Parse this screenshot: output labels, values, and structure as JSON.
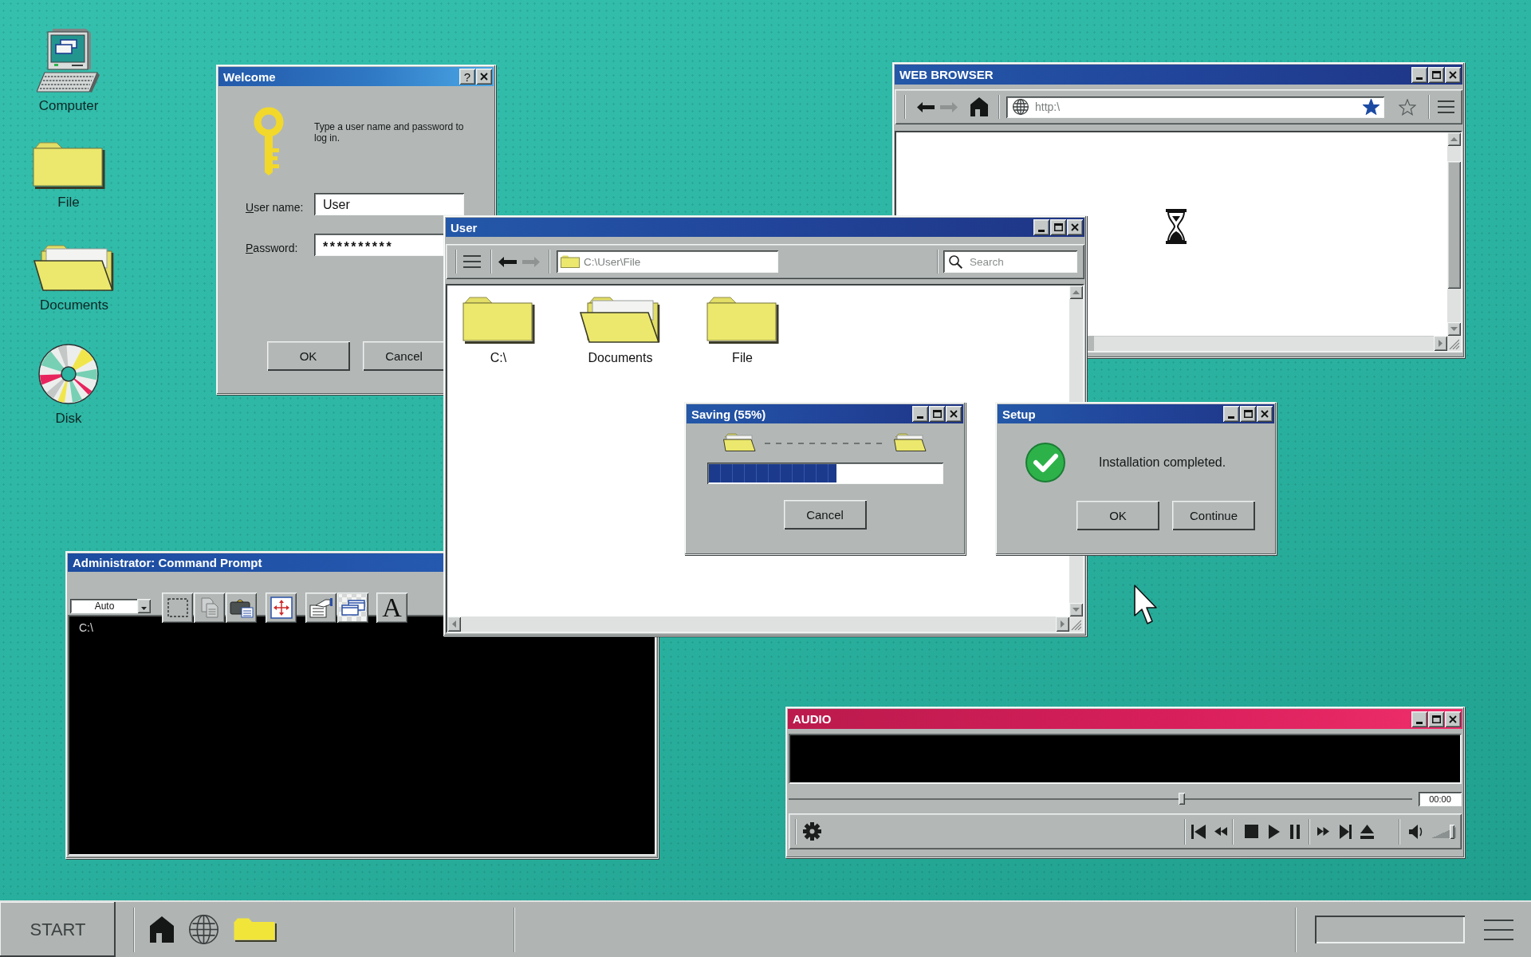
{
  "desktop_icons": [
    {
      "kind": "computer",
      "label": "Computer"
    },
    {
      "kind": "folder",
      "label": "File"
    },
    {
      "kind": "open_folder",
      "label": "Documents"
    },
    {
      "kind": "disk",
      "label": "Disk"
    }
  ],
  "login_dialog": {
    "title": "Welcome",
    "help_button": "?",
    "message": "Type a user name and password to log in.",
    "fields": [
      {
        "kind": "text",
        "label": "User name:",
        "access_key_underlined": true,
        "value": "User"
      },
      {
        "kind": "password",
        "label": "Password:",
        "access_key_underlined": true,
        "value": "**********"
      }
    ],
    "buttons": [
      "OK",
      "Cancel"
    ]
  },
  "browser": {
    "title": "WEB BROWSER",
    "back_disabled": false,
    "forward_disabled": true,
    "address": "http:\\",
    "bookmarked": true,
    "loading": true
  },
  "explorer": {
    "title": "User",
    "back_disabled": false,
    "forward_disabled": true,
    "path": "C:\\User\\File",
    "search_placeholder": "Search",
    "items": [
      {
        "kind": "folder",
        "label": "C:\\"
      },
      {
        "kind": "open_folder",
        "label": "Documents"
      },
      {
        "kind": "folder",
        "label": "File"
      }
    ]
  },
  "saving_dialog": {
    "title": "Saving (55%)",
    "level": 0.55,
    "buttons": [
      "Cancel"
    ]
  },
  "setup_dialog": {
    "title": "Setup",
    "message": "Installation completed.",
    "buttons": [
      "OK",
      "Continue"
    ]
  },
  "command_prompt": {
    "title": "Administrator: Command Prompt",
    "font_size": "Auto",
    "tools": [
      {
        "kind": "select",
        "disabled": false,
        "pressed": false
      },
      {
        "kind": "copy",
        "disabled": true,
        "pressed": false
      },
      {
        "kind": "paste",
        "disabled": false,
        "pressed": false
      },
      {
        "kind": "move",
        "disabled": false,
        "pressed": false
      },
      {
        "kind": "properties",
        "disabled": false,
        "pressed": false
      },
      {
        "kind": "windows",
        "disabled": false,
        "pressed": true
      },
      {
        "kind": "font",
        "label": "A",
        "disabled": false,
        "pressed": false
      }
    ],
    "prompt": "C:\\"
  },
  "audio_player": {
    "title": "AUDIO",
    "seek": {
      "level": 0.63
    },
    "time": "00:00",
    "volume": {
      "level": 0.85
    }
  },
  "taskbar": {
    "start": "START"
  }
}
